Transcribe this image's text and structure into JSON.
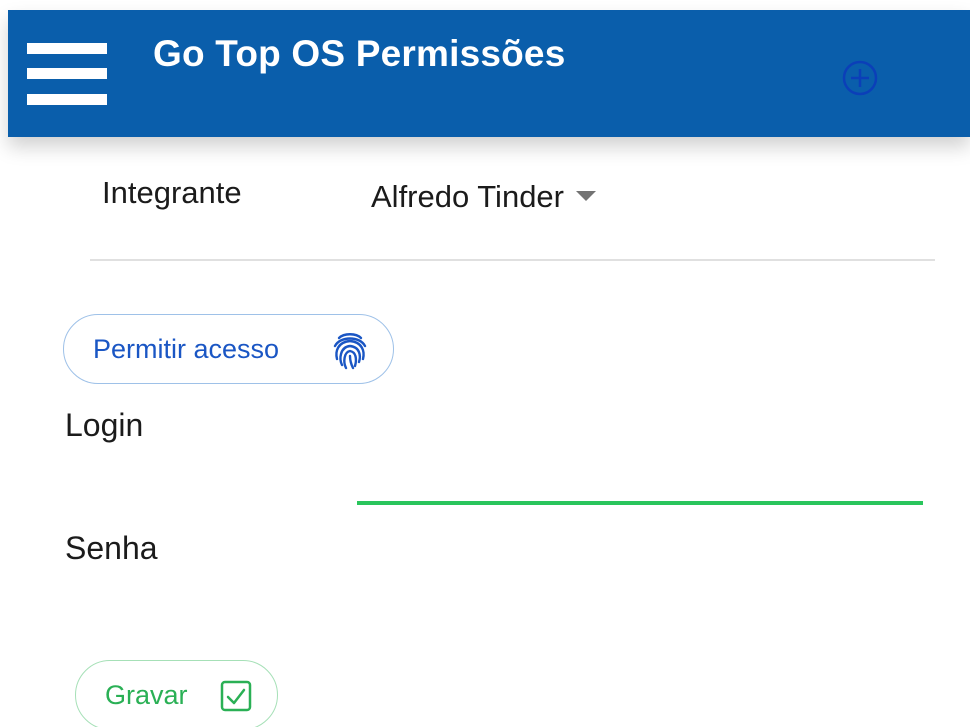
{
  "app_bar": {
    "title": "Go Top OS Permissões",
    "background_color": "#0a5eab",
    "menu_icon": "hamburger-menu-icon",
    "action_icon": "add-circle-icon"
  },
  "form": {
    "integrante": {
      "label": "Integrante",
      "selected_value": "Alfredo Tinder"
    },
    "permitir_button": {
      "label": "Permitir acesso",
      "icon": "fingerprint-icon",
      "color": "#1a56c4"
    },
    "login": {
      "label": "Login",
      "value": "",
      "underline_color": "#2ac55c"
    },
    "senha": {
      "label": "Senha",
      "value": ""
    },
    "gravar_button": {
      "label": "Gravar",
      "icon": "checkbox-checked-icon",
      "color": "#2ab055"
    }
  }
}
